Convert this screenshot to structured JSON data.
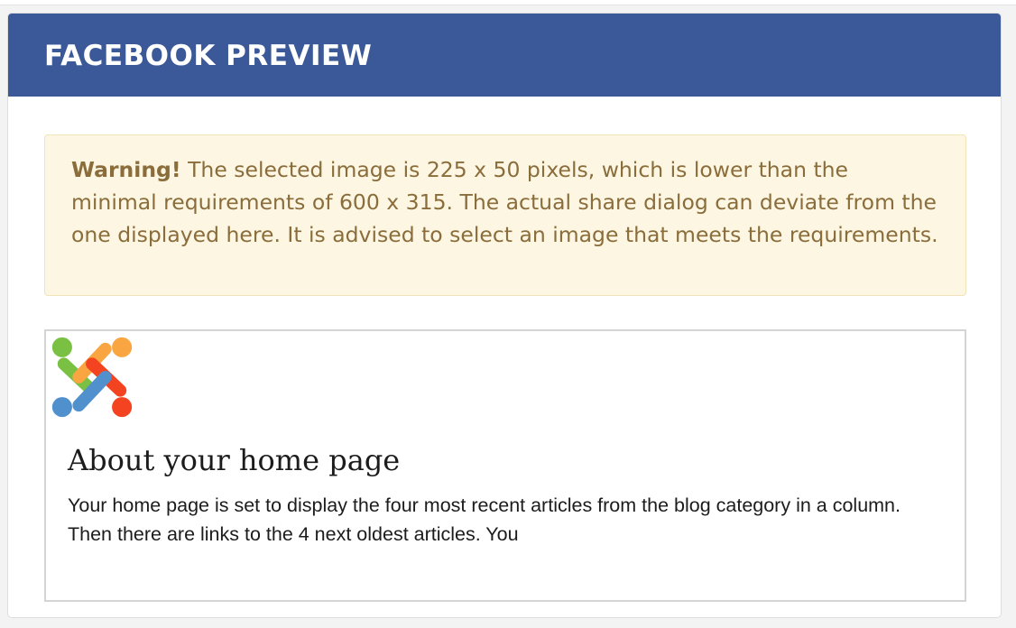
{
  "header": {
    "title": "FACEBOOK PREVIEW"
  },
  "alert": {
    "strong": "Warning!",
    "message": " The selected image is 225 x 50 pixels, which is lower than the minimal requirements of 600 x 315. The actual share dialog can deviate from the one displayed here. It is advised to select an image that meets the requirements."
  },
  "preview": {
    "logo_icon": "joomla-logo-icon",
    "title": "About your home page",
    "description": "Your home page is set to display the four most recent articles from the blog category in a column. Then there are links to the 4 next oldest articles. You"
  },
  "colors": {
    "header_bg": "#3b5998",
    "alert_bg": "#fcf6e2",
    "alert_text": "#8a6d3b"
  }
}
